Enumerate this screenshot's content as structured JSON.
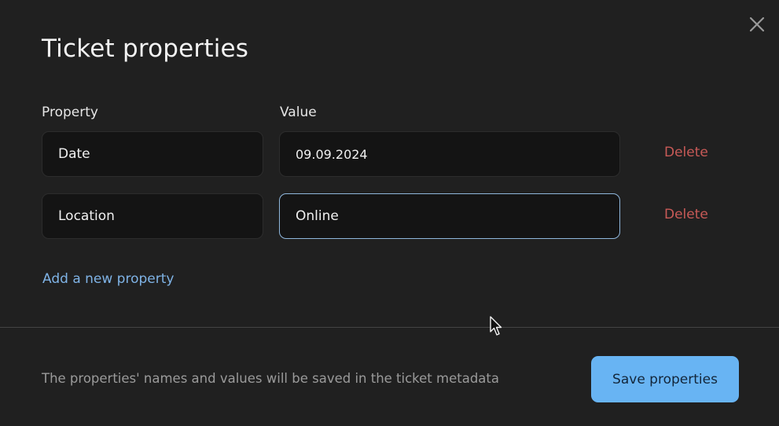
{
  "dialog": {
    "title": "Ticket properties",
    "close_icon": "close-icon"
  },
  "columns": {
    "property": "Property",
    "value": "Value"
  },
  "properties": [
    {
      "name": "Date",
      "value": "09.09.2024",
      "delete_label": "Delete"
    },
    {
      "name": "Location",
      "value": "Online",
      "delete_label": "Delete"
    }
  ],
  "add_property_label": "Add a new property",
  "footer": {
    "note": "The properties' names and values will be saved in the ticket metadata",
    "save_label": "Save properties"
  },
  "colors": {
    "background": "#202020",
    "field_bg": "#141414",
    "accent_blue": "#68b4f3",
    "link_blue": "#7fb3e6",
    "delete_red": "#c85a57",
    "focus_border": "#8fb7dc"
  }
}
